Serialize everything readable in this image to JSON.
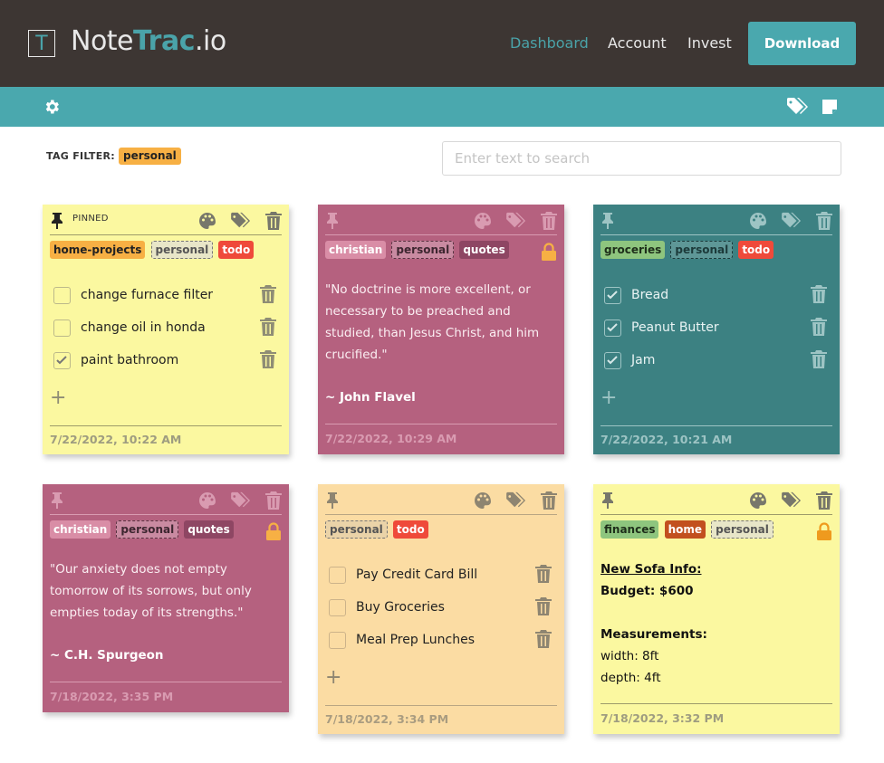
{
  "header": {
    "logo_letter": "T",
    "logo_name_a": "Note",
    "logo_name_b": "Trac",
    "logo_name_c": ".io",
    "nav": [
      "Dashboard",
      "Account",
      "Invest"
    ],
    "download": "Download"
  },
  "toolbar": {
    "settings_icon": "gear-icon",
    "tags_icon": "tags-icon",
    "note_icon": "sticky-note-icon"
  },
  "filter": {
    "label": "TAG FILTER:",
    "tag": "personal"
  },
  "search": {
    "placeholder": "Enter text to search",
    "value": ""
  },
  "colors": {
    "topbar": "#3d3633",
    "accent": "#4aa8ae",
    "yellow": "#fbf8a0",
    "magenta": "#b5617f",
    "teal": "#3c8182",
    "peach": "#fbdca3",
    "orange_tag": "#f7b044",
    "red_tag": "#ef4a3a",
    "green_tag": "#8ec57e"
  },
  "notes": [
    {
      "pinned_label": "PINNED",
      "tags": [
        "home-projects",
        "personal",
        "todo"
      ],
      "items": [
        {
          "label": "change furnace filter",
          "checked": false
        },
        {
          "label": "change oil in honda",
          "checked": false
        },
        {
          "label": "paint bathroom",
          "checked": true
        }
      ],
      "add": "+",
      "timestamp": "7/22/2022, 10:22 AM"
    },
    {
      "tags": [
        "christian",
        "personal",
        "quotes"
      ],
      "quote": "\"No doctrine is more excellent, or necessary to be preached and studied, than Jesus Christ, and him crucified.\"",
      "author": "~ John Flavel",
      "timestamp": "7/22/2022, 10:29 AM"
    },
    {
      "tags": [
        "groceries",
        "personal",
        "todo"
      ],
      "items": [
        {
          "label": "Bread",
          "checked": true
        },
        {
          "label": "Peanut Butter",
          "checked": true
        },
        {
          "label": "Jam",
          "checked": true
        }
      ],
      "add": "+",
      "timestamp": "7/22/2022, 10:21 AM"
    },
    {
      "tags": [
        "christian",
        "personal",
        "quotes"
      ],
      "quote": "\"Our anxiety does not empty tomorrow of its sorrows, but only empties today of its strengths.\"",
      "author": "~ C.H. Spurgeon",
      "timestamp": "7/18/2022, 3:35 PM"
    },
    {
      "tags": [
        "personal",
        "todo"
      ],
      "items": [
        {
          "label": "Pay Credit Card Bill",
          "checked": false
        },
        {
          "label": "Buy Groceries",
          "checked": false
        },
        {
          "label": "Meal Prep Lunches",
          "checked": false
        }
      ],
      "add": "+",
      "timestamp": "7/18/2022, 3:34 PM"
    },
    {
      "tags": [
        "finances",
        "home",
        "personal"
      ],
      "lines": [
        "New Sofa Info:",
        "Budget: $600",
        "Measurements:",
        "width: 8ft",
        "depth: 4ft"
      ],
      "timestamp": "7/18/2022, 3:32 PM"
    }
  ]
}
